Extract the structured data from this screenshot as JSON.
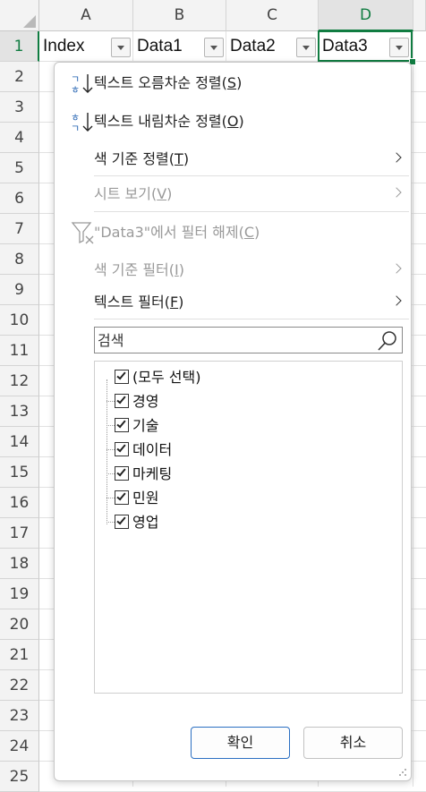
{
  "sheet": {
    "columns": [
      "A",
      "B",
      "C",
      "D"
    ],
    "rows": [
      "1",
      "2",
      "3",
      "4",
      "5",
      "6",
      "7",
      "8",
      "9",
      "10",
      "11",
      "12",
      "13",
      "14",
      "15",
      "16",
      "17",
      "18",
      "19",
      "20",
      "21",
      "22",
      "23",
      "24",
      "25"
    ],
    "header_cells": [
      "Index",
      "Data1",
      "Data2",
      "Data3"
    ],
    "active_column": "D",
    "active_row": "1",
    "accent_color": "#107c41"
  },
  "filter_menu": {
    "sort_asc": {
      "text": "텍스트 오름차순 정렬",
      "key": "S",
      "icon": "sort-ascending-icon"
    },
    "sort_desc": {
      "text": "텍스트 내림차순 정렬",
      "key": "O",
      "icon": "sort-descending-icon"
    },
    "sort_by_color": {
      "text": "색 기준 정렬",
      "key": "T"
    },
    "sheet_view": {
      "text": "시트 보기",
      "key": "V"
    },
    "clear_filter": {
      "text": "\"Data3\"에서 필터 해제",
      "key": "C",
      "icon": "clear-filter-icon"
    },
    "filter_by_color": {
      "text": "색 기준 필터",
      "key": "I"
    },
    "text_filter": {
      "text": "텍스트 필터",
      "key": "F"
    },
    "search_placeholder": "검색",
    "list_items": [
      {
        "label": "(모두 선택)",
        "checked": true
      },
      {
        "label": "경영",
        "checked": true
      },
      {
        "label": "기술",
        "checked": true
      },
      {
        "label": "데이터",
        "checked": true
      },
      {
        "label": "마케팅",
        "checked": true
      },
      {
        "label": "민원",
        "checked": true
      },
      {
        "label": "영업",
        "checked": true
      }
    ],
    "ok_label": "확인",
    "cancel_label": "취소"
  }
}
